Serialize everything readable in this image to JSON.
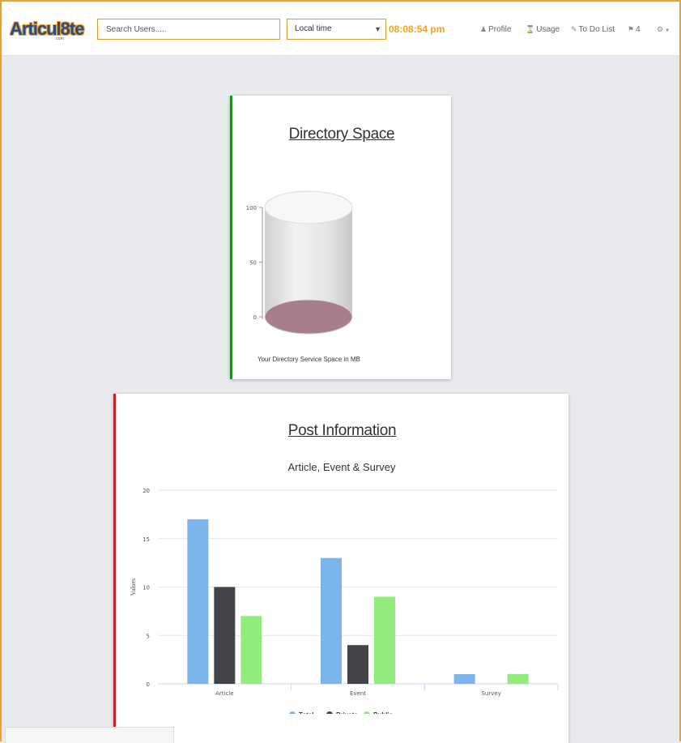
{
  "header": {
    "logo_text": "Articul8te",
    "logo_sub": ".com",
    "search_placeholder": "Search Users.....",
    "timezone_select": "Local time",
    "clock": "08:08:54 pm",
    "nav": {
      "profile": "Profile",
      "usage": "Usage",
      "todo": "To Do List",
      "notifications_count": "4"
    },
    "icons": {
      "profile": "user-icon",
      "usage": "hourglass-icon",
      "todo": "edit-icon",
      "notifications": "bell-icon",
      "settings": "gears-icon"
    },
    "colors": {
      "accent": "#f7a21b",
      "border": "#e09a2a"
    }
  },
  "directory_card": {
    "title": "Directory Space",
    "caption": "Your Directory Service Space in MB",
    "accent_color": "#228b22",
    "chart_data": {
      "type": "cylinder",
      "y_ticks": [
        "0",
        "50",
        "100"
      ],
      "ylim": [
        0,
        100
      ],
      "value": 0,
      "fill_color": "#a87e8c"
    }
  },
  "post_card": {
    "title": "Post Information",
    "accent_color": "#cc1f1f",
    "chart_data": {
      "type": "bar",
      "title": "Article, Event & Survey",
      "ylabel": "Values",
      "xlabel": "",
      "ylim": [
        0,
        20
      ],
      "y_ticks": [
        "0",
        "5",
        "10",
        "15",
        "20"
      ],
      "categories": [
        "Article",
        "Event",
        "Survey"
      ],
      "series": [
        {
          "name": "Total",
          "values": [
            17,
            13,
            1
          ],
          "color": "#7cb5ec"
        },
        {
          "name": "Private",
          "values": [
            10,
            4,
            0
          ],
          "color": "#434348"
        },
        {
          "name": "Public",
          "values": [
            7,
            9,
            1
          ],
          "color": "#90ed7d"
        }
      ],
      "legend_position": "bottom",
      "grid": true
    }
  }
}
